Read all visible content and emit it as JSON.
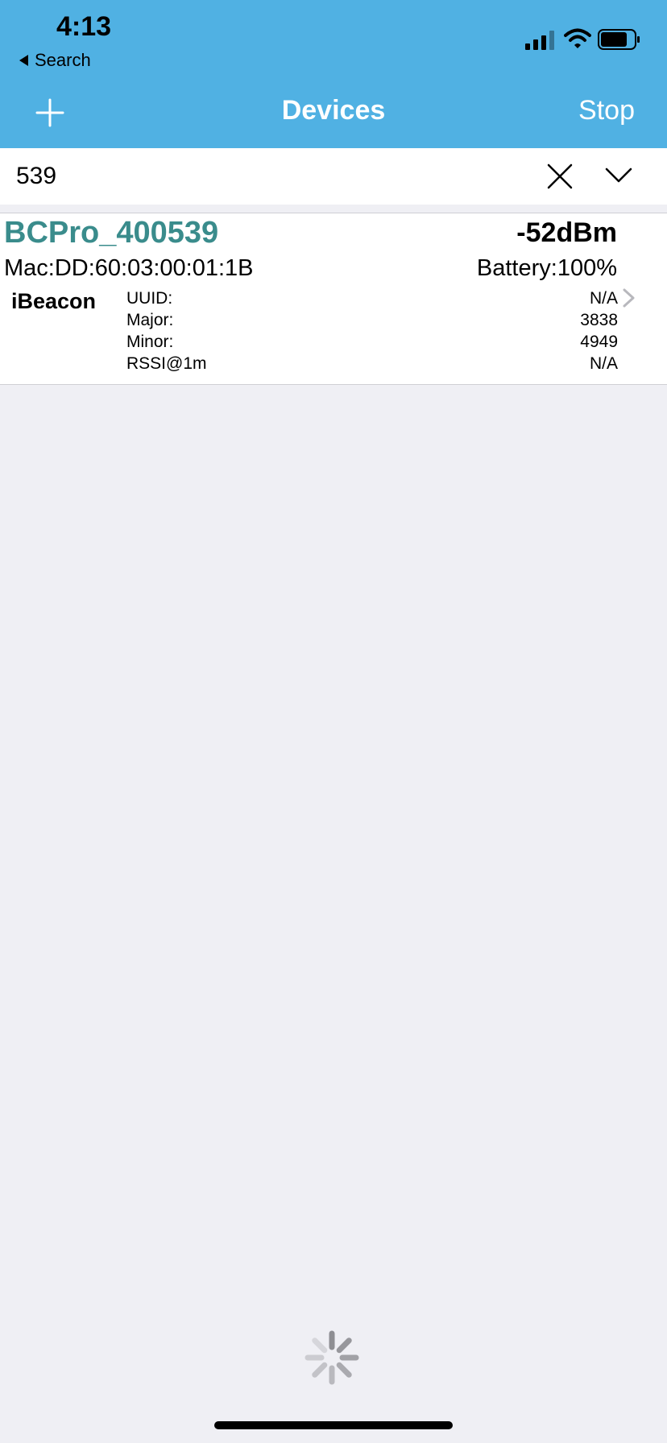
{
  "status_bar": {
    "time": "4:13",
    "back_label": "Search"
  },
  "nav": {
    "title": "Devices",
    "stop_label": "Stop"
  },
  "search": {
    "value": "539"
  },
  "devices": [
    {
      "name": "BCPro_400539",
      "rssi": "-52dBm",
      "mac": "Mac:DD:60:03:00:01:1B",
      "battery": "Battery:100%",
      "type": "iBeacon",
      "fields": [
        {
          "label": "UUID:",
          "value": "N/A"
        },
        {
          "label": "Major:",
          "value": "3838"
        },
        {
          "label": "Minor:",
          "value": "4949"
        },
        {
          "label": "RSSI@1m",
          "value": "N/A"
        }
      ]
    }
  ],
  "colors": {
    "nav_background": "#50b1e3",
    "device_name": "#3a8c8c",
    "page_background": "#efeff4"
  },
  "icons": {
    "add": "plus-icon",
    "clear": "close-icon",
    "filter": "chevron-down-icon",
    "detail": "chevron-right-icon",
    "loading": "spinner-icon"
  }
}
